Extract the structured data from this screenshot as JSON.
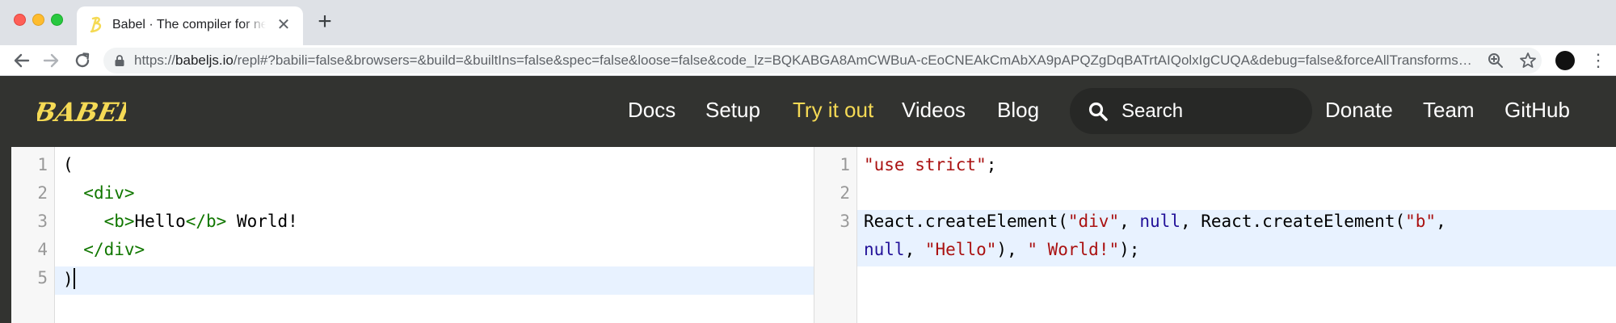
{
  "browser": {
    "tab_title": "Babel · The compiler for next generation JavaScript",
    "tab_close_icon": "✕",
    "new_tab_icon": "+",
    "url_scheme": "https://",
    "url_host": "babeljs.io",
    "url_path": "/repl#?babili=false&browsers=&build=&builtIns=false&spec=false&loose=false&code_lz=BQKABGA8AmCWBuA-cEoCNEAkCmAbXA9pAPQZgDqBATrtAIQolxIgCUQA&debug=false&forceAllTransforms=false",
    "menu_icon": "⋮"
  },
  "header": {
    "logo_text": "BABEL",
    "nav_left": [
      "Docs",
      "Setup",
      "Try it out",
      "Videos",
      "Blog"
    ],
    "active_nav": "Try it out",
    "search_placeholder": "Search",
    "nav_right": [
      "Donate",
      "Team",
      "GitHub"
    ]
  },
  "left_editor": {
    "line_numbers": [
      "1",
      "2",
      "3",
      "4",
      "5"
    ],
    "lines": {
      "l1": "(",
      "l2_tag": "<div>",
      "l3_open": "<b>",
      "l3_hello": "Hello",
      "l3_close": "</b>",
      "l3_world": " World!",
      "l4_tag": "</div>",
      "l5": ")"
    }
  },
  "right_editor": {
    "line_numbers": [
      "1",
      "2",
      "3"
    ],
    "lines": {
      "l1_str": "\"use strict\"",
      "l1_semi": ";",
      "l3_a": "React.createElement(",
      "l3_div": "\"div\"",
      "l3_b": ", ",
      "l3_null1": "null",
      "l3_c": ", React.createElement(",
      "l3_bstr": "\"b\"",
      "l3_d": ",",
      "l4_null2": "null",
      "l4_a": ", ",
      "l4_hello": "\"Hello\"",
      "l4_b": "), ",
      "l4_world": "\" World!\"",
      "l4_c": ");"
    }
  },
  "colors": {
    "header_bg": "#323330",
    "brand_yellow": "#f5da55",
    "tag_green": "#117700",
    "string_red": "#aa1111",
    "keyword_blue": "#221199",
    "active_line": "#e8f2ff"
  }
}
